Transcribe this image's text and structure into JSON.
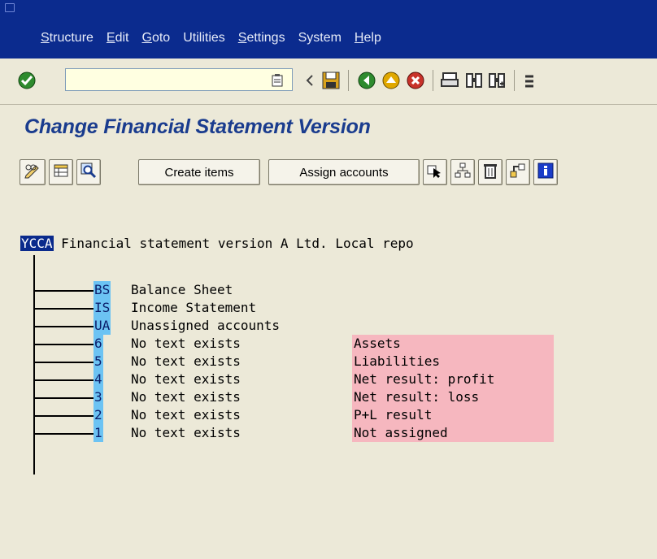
{
  "menubar": {
    "items": [
      {
        "label": "Structure",
        "u": "S",
        "rest": "tructure"
      },
      {
        "label": "Edit",
        "u": "E",
        "rest": "dit"
      },
      {
        "label": "Goto",
        "u": "G",
        "rest": "oto"
      },
      {
        "label": "Utilities",
        "u": "",
        "rest": "Utilities"
      },
      {
        "label": "Settings",
        "u": "S",
        "rest": "ettings"
      },
      {
        "label": "System",
        "u": "",
        "rest": "System"
      },
      {
        "label": "Help",
        "u": "H",
        "rest": "elp"
      }
    ]
  },
  "toolbar": {
    "command_value": ""
  },
  "title": "Change Financial Statement Version",
  "app_toolbar": {
    "create_items": "Create items",
    "assign_accounts": "Assign accounts"
  },
  "tree": {
    "root": {
      "code": "YCCA",
      "text": " Financial statement version A Ltd. Local repo"
    },
    "nodes": [
      {
        "code": "BS",
        "text": "Balance Sheet",
        "pos": ""
      },
      {
        "code": "IS",
        "text": "Income Statement",
        "pos": ""
      },
      {
        "code": "UA",
        "text": "Unassigned accounts",
        "pos": ""
      },
      {
        "code": "6",
        "text": "No text exists",
        "pos": "Assets"
      },
      {
        "code": "5",
        "text": "No text exists",
        "pos": "Liabilities"
      },
      {
        "code": "4",
        "text": "No text exists",
        "pos": "Net result: profit"
      },
      {
        "code": "3",
        "text": "No text exists",
        "pos": "Net result: loss"
      },
      {
        "code": "2",
        "text": "No text exists",
        "pos": "P+L result"
      },
      {
        "code": "1",
        "text": "No text exists",
        "pos": "Not assigned"
      }
    ]
  },
  "colors": {
    "title": "#1A3C8E",
    "menubar": "#0B2B8E",
    "code_bg": "#6CC3F3",
    "pos_bg": "#F6B7BF"
  }
}
